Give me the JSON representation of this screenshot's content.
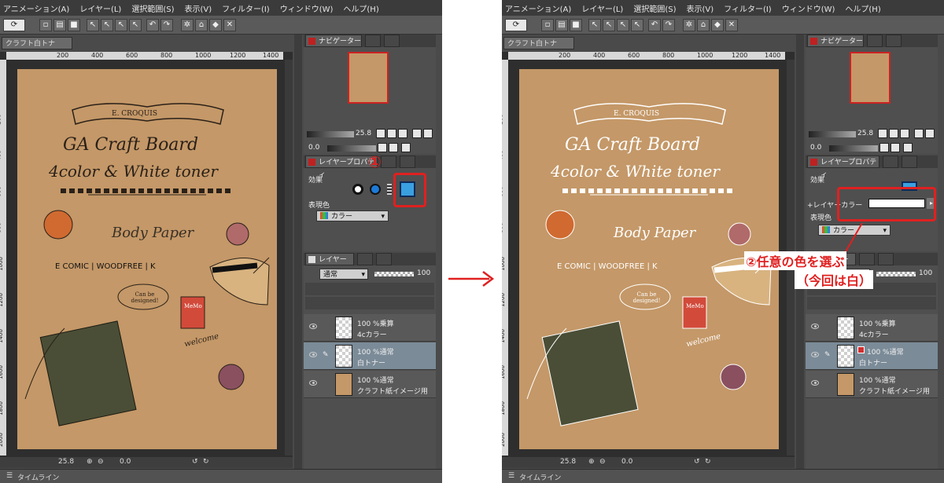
{
  "menu": [
    "アニメーション(A)",
    "レイヤー(L)",
    "選択範囲(S)",
    "表示(V)",
    "フィルター(I)",
    "ウィンドウ(W)",
    "ヘルプ(H)"
  ],
  "document_tab": "クラフト白トナー.tif*",
  "ruler": {
    "top_ticks": [
      "200",
      "400",
      "600",
      "800",
      "1000",
      "1200",
      "1400"
    ],
    "left_ticks": [
      "200",
      "400",
      "600",
      "800",
      "1000",
      "1200",
      "1400",
      "1600",
      "1800",
      "2000"
    ]
  },
  "artwork": {
    "banner": "E. CROQUIS",
    "title1": "GA Craft Board",
    "title2": "4color & White toner",
    "body_paper": "Body Paper",
    "paper_types": "E COMIC | WOODFREE | K",
    "bubble": "Can be designed!",
    "memo": "MeMo",
    "welcome": "welcome"
  },
  "status": {
    "zoom": "25.8",
    "angle": "0.0"
  },
  "timeline_label": "タイムライン",
  "navigator": {
    "tab": "ナビゲーター",
    "zoom": "25.8",
    "angle": "0.0"
  },
  "layer_property": {
    "tab": "レイヤープロパティ",
    "effect_label": "効果",
    "expression_color_label": "表現色",
    "expression_color_value": "カラー",
    "layer_color_label": "+レイヤーカラー"
  },
  "layers_panel": {
    "tab": "レイヤー",
    "blend_mode": "通常",
    "opacity": "100",
    "rows": [
      {
        "line1": "100 %乗算",
        "line2": "4cカラー"
      },
      {
        "line1": "100 %通常",
        "line2": "白トナー"
      },
      {
        "line1": "100 %通常",
        "line2": "クラフト紙イメージ用"
      }
    ]
  },
  "annotations": {
    "step1": "①",
    "step2_line1": "②任意の色を選ぶ",
    "step2_line2": "（今回は白）",
    "arrow": "→"
  },
  "colors": {
    "kraft": "#c49868",
    "red": "#e02020",
    "selected_layer": "#7b8b98"
  }
}
